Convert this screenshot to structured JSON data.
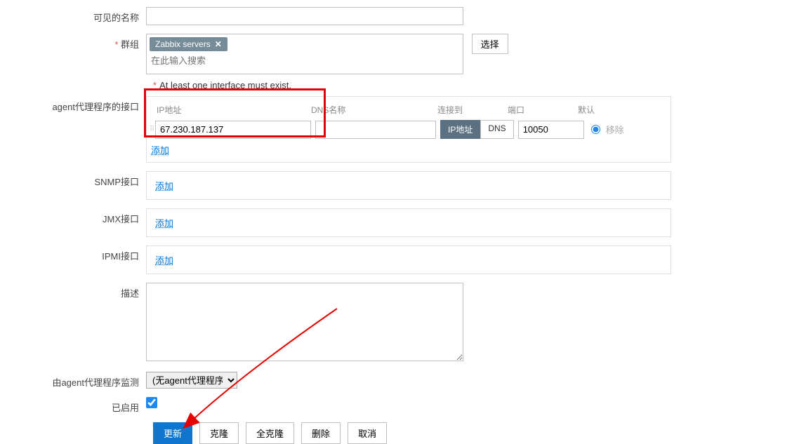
{
  "labels": {
    "visible_name": "可见的名称",
    "groups": "群组",
    "select_btn": "选择",
    "group_placeholder": "在此输入搜索",
    "interface_required_msg": "At least one interface must exist.",
    "agent_interface": "agent代理程序的接口",
    "snmp_interface": "SNMP接口",
    "jmx_interface": "JMX接口",
    "ipmi_interface": "IPMI接口",
    "description": "描述",
    "monitored_by_proxy": "由agent代理程序监测",
    "enabled": "已启用"
  },
  "groups": {
    "tag": "Zabbix servers"
  },
  "iface_headers": {
    "ip": "IP地址",
    "dns": "DNS名称",
    "connect": "连接到",
    "port": "端口",
    "default": "默认"
  },
  "interfaces": {
    "agent": {
      "ip": "67.230.187.137",
      "dns": "",
      "port": "10050",
      "connect_ip": "IP地址",
      "connect_dns": "DNS"
    },
    "add_label": "添加",
    "remove_label": "移除"
  },
  "proxy_select": "(无agent代理程序)",
  "buttons": {
    "update": "更新",
    "clone": "克隆",
    "full_clone": "全克隆",
    "delete": "删除",
    "cancel": "取消"
  }
}
